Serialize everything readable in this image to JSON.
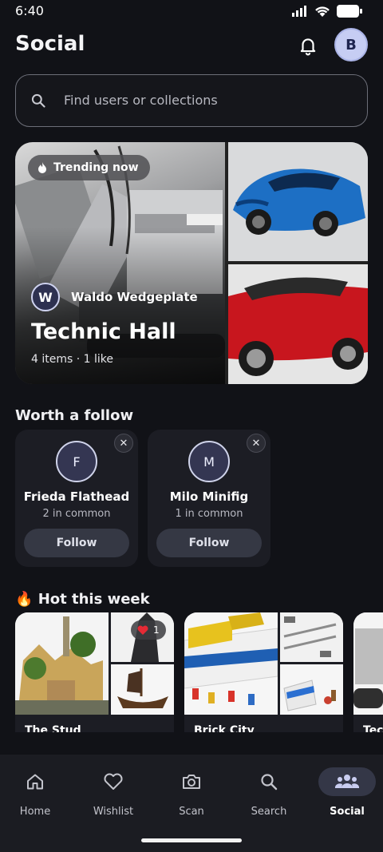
{
  "status_bar": {
    "time": "6:40"
  },
  "header": {
    "title": "Social",
    "avatar_initial": "B"
  },
  "search": {
    "placeholder": "Find users or collections"
  },
  "featured": {
    "badge": "Trending now",
    "owner_initial": "W",
    "owner_name": "Waldo Wedgeplate",
    "title": "Technic Hall",
    "meta": "4 items · 1 like"
  },
  "follow_section": {
    "title": "Worth a follow",
    "close_glyph": "✕",
    "users": [
      {
        "initial": "F",
        "name": "Frieda Flathead",
        "common": "2 in common",
        "button": "Follow"
      },
      {
        "initial": "M",
        "name": "Milo Minifig",
        "common": "1 in common",
        "button": "Follow"
      }
    ]
  },
  "hot_section": {
    "emoji": "🔥",
    "title": "Hot this week",
    "collections": [
      {
        "name": "The Stud",
        "likes": "1"
      },
      {
        "name": "Brick City",
        "likes": ""
      },
      {
        "name": "Tec",
        "likes": ""
      }
    ]
  },
  "bottom_nav": {
    "items": [
      {
        "label": "Home",
        "icon": "home-icon",
        "active": false
      },
      {
        "label": "Wishlist",
        "icon": "heart-icon",
        "active": false
      },
      {
        "label": "Scan",
        "icon": "camera-icon",
        "active": false
      },
      {
        "label": "Search",
        "icon": "search-icon",
        "active": false
      },
      {
        "label": "Social",
        "icon": "people-icon",
        "active": true
      }
    ]
  },
  "colors": {
    "background": "#111217",
    "card": "#1c1d24",
    "accent_avatar": "#c6cdf3",
    "active_nav": "#343747"
  }
}
